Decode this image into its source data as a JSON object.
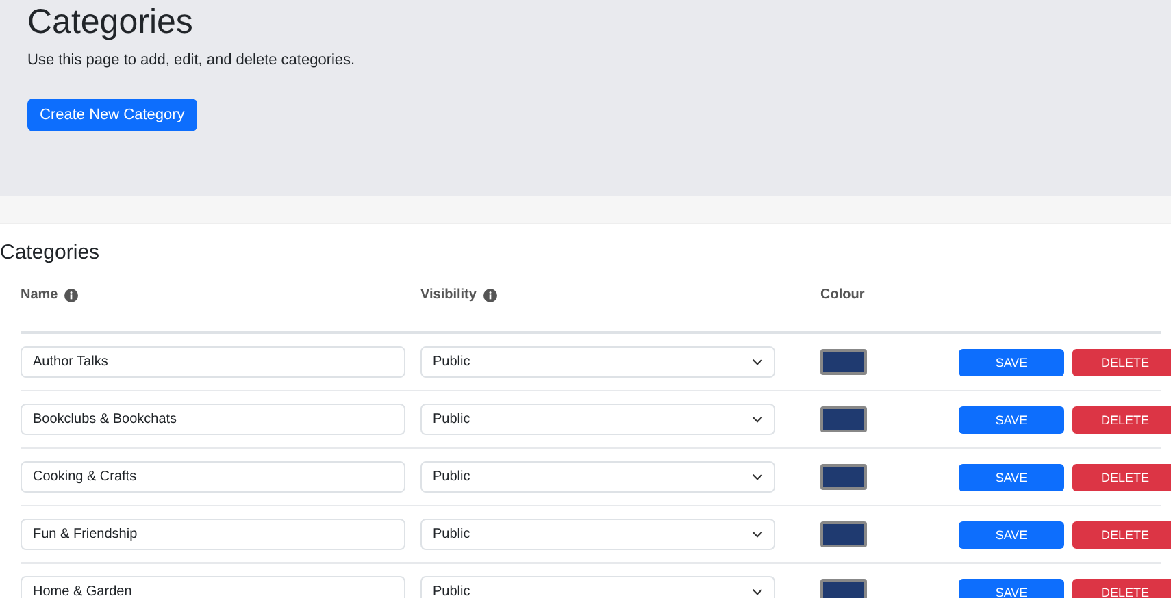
{
  "header": {
    "title": "Categories",
    "description": "Use this page to add, edit, and delete categories.",
    "create_button": "Create New Category"
  },
  "section": {
    "title": "Categories",
    "columns": [
      {
        "label": "Name",
        "info": true
      },
      {
        "label": "Visibility",
        "info": true
      },
      {
        "label": "Colour",
        "info": false
      }
    ],
    "rows": [
      {
        "name": "Author Talks",
        "visibility": "Public",
        "color": "#1f3a70",
        "save": "SAVE",
        "delete": "DELETE"
      },
      {
        "name": "Bookclubs & Bookchats",
        "visibility": "Public",
        "color": "#1f3a70",
        "save": "SAVE",
        "delete": "DELETE"
      },
      {
        "name": "Cooking & Crafts",
        "visibility": "Public",
        "color": "#1f3a70",
        "save": "SAVE",
        "delete": "DELETE"
      },
      {
        "name": "Fun & Friendship",
        "visibility": "Public",
        "color": "#1f3a70",
        "save": "SAVE",
        "delete": "DELETE"
      },
      {
        "name": "Home & Garden",
        "visibility": "Public",
        "color": "#1f3a70",
        "save": "SAVE",
        "delete": "DELETE"
      }
    ]
  }
}
